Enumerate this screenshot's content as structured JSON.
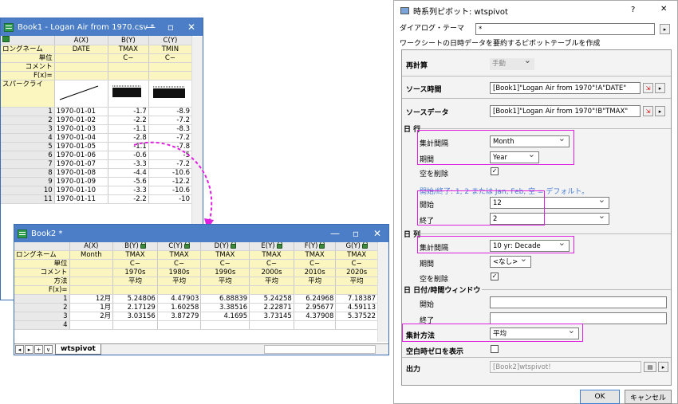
{
  "book1": {
    "title": "Book1 - Logan Air from 1970.csv *",
    "col_headers": [
      "A(X)",
      "B(Y)",
      "C(Y)"
    ],
    "labels": [
      "ロングネーム",
      "単位",
      "コメント",
      "F(x)=",
      "スパークライ"
    ],
    "longname": [
      "DATE",
      "TMAX",
      "TMIN"
    ],
    "units": [
      "",
      "C−",
      "C−"
    ],
    "rows": [
      [
        "1",
        "1970-01-01",
        "-1.7",
        "-8.9"
      ],
      [
        "2",
        "1970-01-02",
        "-2.2",
        "-7.2"
      ],
      [
        "3",
        "1970-01-03",
        "-1.1",
        "-8.3"
      ],
      [
        "4",
        "1970-01-04",
        "-2.8",
        "-7.2"
      ],
      [
        "5",
        "1970-01-05",
        "-1.1",
        "-7.8"
      ],
      [
        "6",
        "1970-01-06",
        "-0.6",
        "-5"
      ],
      [
        "7",
        "1970-01-07",
        "-3.3",
        "-7.2"
      ],
      [
        "8",
        "1970-01-08",
        "-4.4",
        "-10.6"
      ],
      [
        "9",
        "1970-01-09",
        "-5.6",
        "-12.2"
      ],
      [
        "10",
        "1970-01-10",
        "-3.3",
        "-10.6"
      ],
      [
        "11",
        "1970-01-11",
        "-2.2",
        "-10"
      ]
    ]
  },
  "book2": {
    "title": "Book2 *",
    "col_headers": [
      "A(X)",
      "B(Y)",
      "C(Y)",
      "D(Y)",
      "E(Y)",
      "F(Y)",
      "G(Y)"
    ],
    "labels": [
      "ロングネーム",
      "単位",
      "コメント",
      "方法",
      "F(x)="
    ],
    "longname": [
      "Month",
      "TMAX",
      "TMAX",
      "TMAX",
      "TMAX",
      "TMAX",
      "TMAX"
    ],
    "units": [
      "",
      "C−",
      "C−",
      "C−",
      "C−",
      "C−",
      "C−"
    ],
    "comments": [
      "",
      "1970s",
      "1980s",
      "1990s",
      "2000s",
      "2010s",
      "2020s"
    ],
    "methods": [
      "",
      "平均",
      "平均",
      "平均",
      "平均",
      "平均",
      "平均"
    ],
    "rows": [
      [
        "1",
        "12月",
        "5.24806",
        "4.47903",
        "6.88839",
        "5.24258",
        "6.24968",
        "7.18387"
      ],
      [
        "2",
        "1月",
        "2.17129",
        "1.60258",
        "3.38516",
        "2.22871",
        "2.95677",
        "4.59113"
      ],
      [
        "3",
        "2月",
        "3.03156",
        "3.87279",
        "4.1695",
        "3.73145",
        "4.37908",
        "5.37522"
      ],
      [
        "4",
        "",
        "",
        "",
        "",
        "",
        "",
        ""
      ]
    ],
    "sheet_tab": "wtspivot"
  },
  "dialog": {
    "title": "時系列ピボット: wtspivot",
    "help": "?",
    "close": "✕",
    "theme_label": "ダイアログ・テーマ",
    "theme_value": "*",
    "description": "ワークシートの日時データを要約するピボットテーブルを作成",
    "recalc_label": "再計算",
    "recalc_value": "手動",
    "source_time_label": "ソース時間",
    "source_time_value": "[Book1]\"Logan Air from 1970\"!A\"DATE\"",
    "source_data_label": "ソースデータ",
    "source_data_value": "[Book1]\"Logan Air from 1970\"!B\"TMAX\"",
    "rows_group": "日 行",
    "interval_label": "集計間隔",
    "interval_value": "Month",
    "period_label": "期間",
    "period_value": "Year",
    "remove_blank_label": "空を削除",
    "hint": "開始/終了: 1, 2 または Jan, Feb, 空 = デフォルト。",
    "start_label": "開始",
    "start_value": "12",
    "end_label": "終了",
    "end_value": "2",
    "cols_group": "日 列",
    "col_interval_label": "集計間隔",
    "col_interval_value": "10 yr: Decade",
    "col_period_label": "期間",
    "col_period_value": "<なし>",
    "col_remove_blank_label": "空を削除",
    "dtw_group": "日 日付/時間ウィンドウ",
    "dtw_start_label": "開始",
    "dtw_end_label": "終了",
    "method_label": "集計方法",
    "method_value": "平均",
    "show_zero_label": "空白時ゼロを表示",
    "output_label": "出力",
    "output_value": "[Book2]wtspivot!",
    "ok_label": "OK",
    "cancel_label": "キャンセル"
  }
}
